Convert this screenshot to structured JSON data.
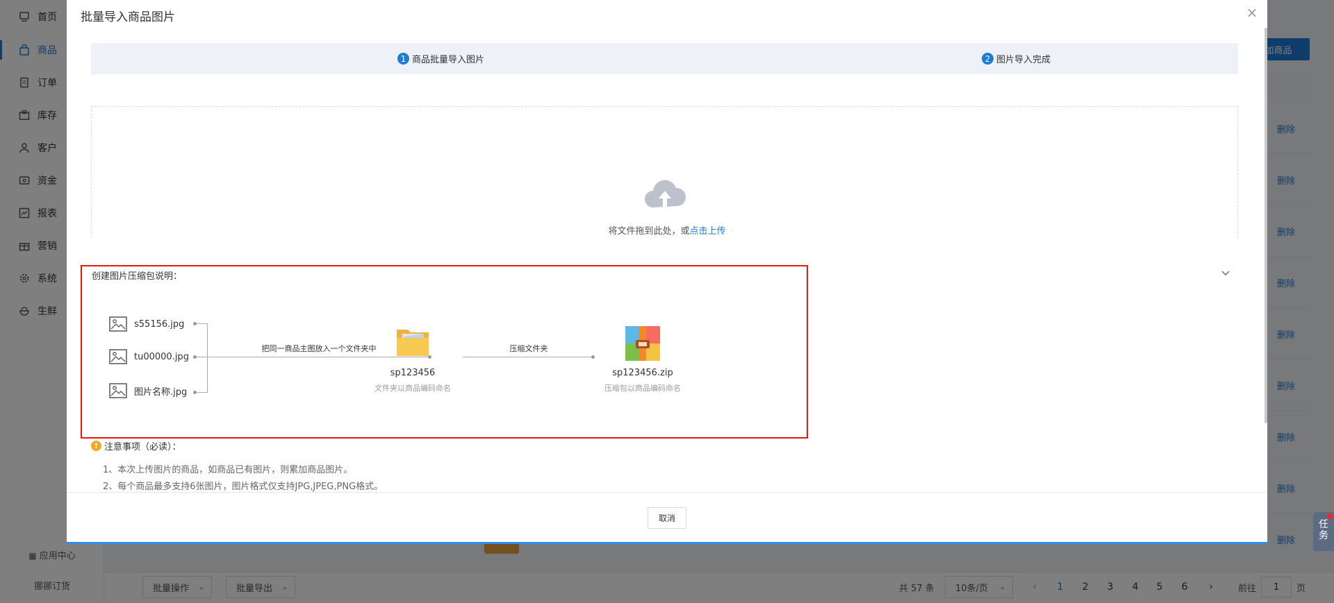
{
  "sidebar": {
    "items": [
      {
        "label": "首页",
        "icon": "home-icon"
      },
      {
        "label": "商品",
        "icon": "bag-icon",
        "active": true
      },
      {
        "label": "订单",
        "icon": "order-icon"
      },
      {
        "label": "库存",
        "icon": "inventory-icon"
      },
      {
        "label": "客户",
        "icon": "user-icon"
      },
      {
        "label": "资金",
        "icon": "wallet-icon"
      },
      {
        "label": "报表",
        "icon": "chart-icon"
      },
      {
        "label": "营销",
        "icon": "gift-icon"
      },
      {
        "label": "系统",
        "icon": "gear-icon"
      },
      {
        "label": "生鲜",
        "icon": "fresh-icon"
      }
    ],
    "app_center": "应用中心",
    "brand": "挪挪订货"
  },
  "background": {
    "add_button": "加商品",
    "delete_label": "删除",
    "batch_ops": "批量操作",
    "batch_export": "批量导出",
    "total": "共 57 条",
    "page_size": "10条/页",
    "pages": [
      "1",
      "2",
      "3",
      "4",
      "5",
      "6"
    ],
    "current_page": "1",
    "goto_label": "前往",
    "goto_value": "1",
    "page_unit": "页",
    "task_label": "任务"
  },
  "modal": {
    "title": "批量导入商品图片",
    "close": "×",
    "steps": [
      {
        "num": "1",
        "label": "商品批量导入图片"
      },
      {
        "num": "2",
        "label": "图片导入完成"
      }
    ],
    "upload": {
      "text": "将文件拖到此处，或",
      "link": "点击上传"
    },
    "guide": {
      "title": "创建图片压缩包说明：",
      "files": [
        "s55156.jpg",
        "tu00000.jpg",
        "图片名称.jpg"
      ],
      "step1_label": "把同一商品主图放入一个文件夹中",
      "folder_name": "sp123456",
      "folder_sub": "文件夹以商品编码命名",
      "step2_label": "压缩文件夹",
      "zip_name": "sp123456.zip",
      "zip_sub": "压缩包以商品编码命名"
    },
    "notice": {
      "title": "注意事项（必读）：",
      "lines": [
        "1、本次上传图片的商品，如商品已有图片，则累加商品图片。",
        "2、每个商品最多支持6张图片，图片格式仅支持JPG,JPEG,PNG格式。"
      ]
    },
    "cancel": "取消"
  },
  "colors": {
    "accent": "#1e7bd6",
    "highlight_border": "#e8190c",
    "warning": "#f5a623"
  }
}
